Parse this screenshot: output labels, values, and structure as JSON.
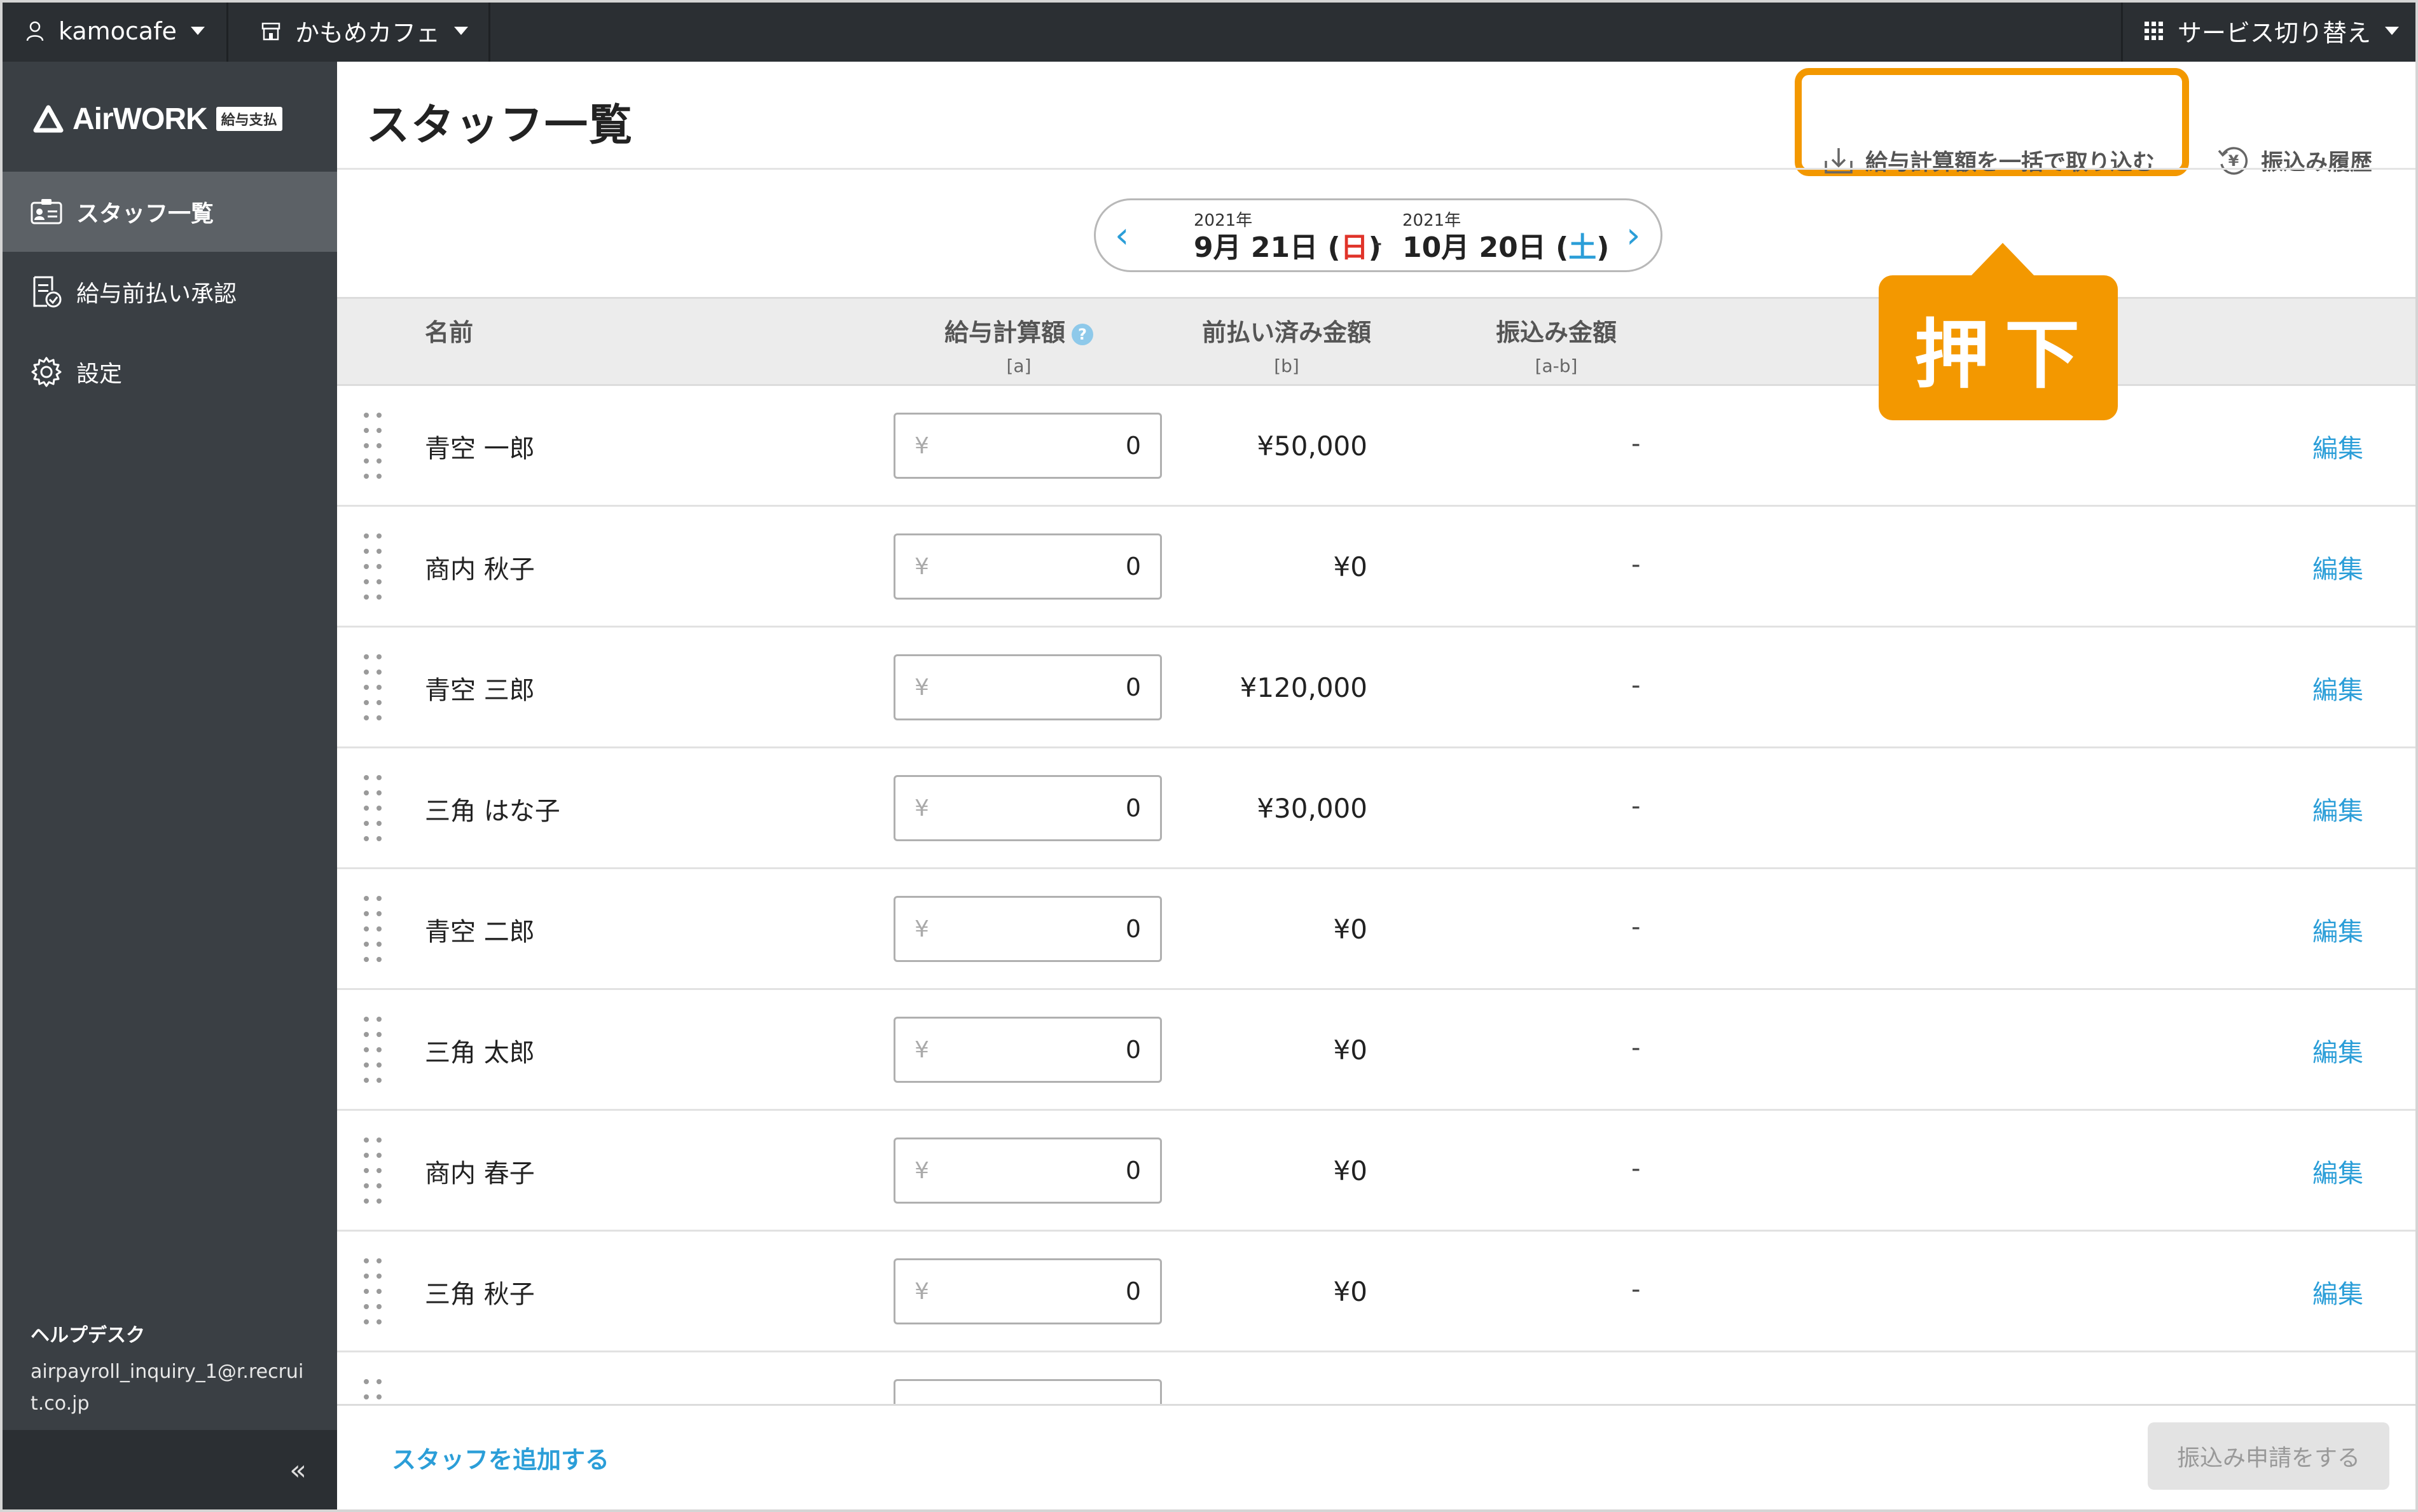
{
  "topbar": {
    "account": "kamocafe",
    "store": "かもめカフェ",
    "service_switch": "サービス切り替え"
  },
  "sidebar": {
    "logo": {
      "brand": "AirWORK",
      "badge": "給与支払"
    },
    "items": [
      {
        "label": "スタッフ一覧",
        "icon": "staff-card-icon",
        "active": true
      },
      {
        "label": "給与前払い承認",
        "icon": "document-check-icon",
        "active": false
      },
      {
        "label": "設定",
        "icon": "gear-icon",
        "active": false
      }
    ],
    "helpdesk": {
      "title": "ヘルプデスク",
      "email": "airpayroll_inquiry_1@r.recruit.co.jp"
    },
    "collapse": "«"
  },
  "header": {
    "title": "スタッフ一覧",
    "import_button": "給与計算額を一括で取り込む",
    "history_button": "振込み履歴",
    "callout": "押下",
    "accent_color": "#f39800"
  },
  "date_range": {
    "start_year": "2021年",
    "start_date": "9月 21日",
    "start_dow": "日",
    "separator": "-",
    "end_year": "2021年",
    "end_date": "10月 20日",
    "end_dow": "土"
  },
  "table": {
    "columns": {
      "name": "名前",
      "pay": "給与計算額",
      "pay_sub": "[a]",
      "prepaid": "前払い済み金額",
      "prepaid_sub": "[b]",
      "transfer": "振込み金額",
      "transfer_sub": "[a-b]"
    },
    "yen_symbol": "¥",
    "edit_label": "編集",
    "rows": [
      {
        "name": "青空 一郎",
        "pay": "0",
        "prepaid": "¥50,000",
        "transfer": "-"
      },
      {
        "name": "商内 秋子",
        "pay": "0",
        "prepaid": "¥0",
        "transfer": "-"
      },
      {
        "name": "青空 三郎",
        "pay": "0",
        "prepaid": "¥120,000",
        "transfer": "-"
      },
      {
        "name": "三角 はな子",
        "pay": "0",
        "prepaid": "¥30,000",
        "transfer": "-"
      },
      {
        "name": "青空 二郎",
        "pay": "0",
        "prepaid": "¥0",
        "transfer": "-"
      },
      {
        "name": "三角 太郎",
        "pay": "0",
        "prepaid": "¥0",
        "transfer": "-"
      },
      {
        "name": "商内 春子",
        "pay": "0",
        "prepaid": "¥0",
        "transfer": "-"
      },
      {
        "name": "三角 秋子",
        "pay": "0",
        "prepaid": "¥0",
        "transfer": "-"
      }
    ]
  },
  "footer": {
    "add_staff": "スタッフを追加する",
    "submit": "振込み申請をする"
  }
}
